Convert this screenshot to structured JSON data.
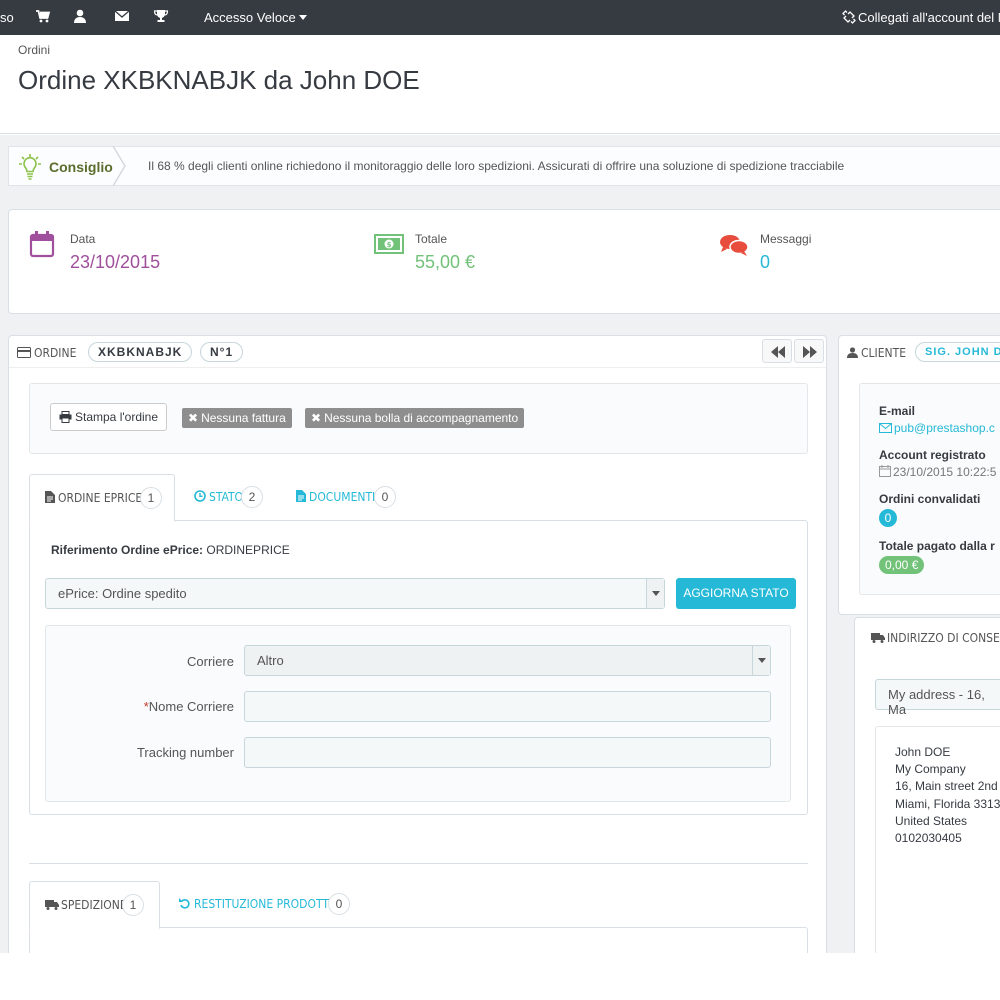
{
  "topbar": {
    "left_fragment": "so",
    "quick_access": "Accesso Veloce",
    "connect": "Collegati all'account del M",
    "icons": [
      "cart-icon",
      "user-icon",
      "envelope-icon",
      "trophy-icon"
    ]
  },
  "header": {
    "breadcrumb": "Ordini",
    "title": "Ordine XKBKNABJK da John DOE"
  },
  "tip": {
    "label": "Consiglio",
    "text": "Il 68 % degli clienti online richiedono il monitoraggio delle loro spedizioni. Assicurati di offrire una soluzione di spedizione tracciabile"
  },
  "kpis": [
    {
      "label": "Data",
      "value": "23/10/2015",
      "color": "#a04f9c"
    },
    {
      "label": "Totale",
      "value": "55,00 €",
      "color": "#72c279"
    },
    {
      "label": "Messaggi",
      "value": "0",
      "color": "#25b9d7"
    }
  ],
  "order_panel": {
    "title": "ORDINE",
    "reference": "XKBKNABJK",
    "number": "N°1",
    "print_button": "Stampa l'ordine",
    "tag_invoice": "Nessuna fattura",
    "tag_delivery": "Nessuna bolla di accompagnamento",
    "tabs": [
      {
        "label": "ORDINE EPRICE",
        "count": "1"
      },
      {
        "label": "STATO",
        "count": "2"
      },
      {
        "label": "DOCUMENTI",
        "count": "0"
      }
    ],
    "eprice_ref_label": "Riferimento Ordine ePrice:",
    "eprice_ref_value": "ORDINEPRICE",
    "status_select": "ePrice: Ordine spedito",
    "update_button": "AGGIORNA STATO",
    "carrier_label": "Corriere",
    "carrier_value": "Altro",
    "carrier_name_required": "*",
    "carrier_name_label": "Nome Corriere",
    "tracking_label": "Tracking number",
    "bottom_tabs": [
      {
        "label": "SPEDIZIONE",
        "count": "1"
      },
      {
        "label": "RESTITUZIONE PRODOTTO",
        "count": "0"
      }
    ]
  },
  "customer_panel": {
    "title": "CLIENTE",
    "name": "SIG. JOHN DO",
    "email_label": "E-mail",
    "email": "pub@prestashop.c",
    "registered_label": "Account registrato",
    "registered": "23/10/2015 10:22:5",
    "orders_label": "Ordini convalidati",
    "orders": "0",
    "paid_label": "Totale pagato dalla r",
    "paid": "0,00 €"
  },
  "address_panel": {
    "title": "INDIRIZZO DI CONSEGN",
    "select": "My address - 16, Ma",
    "lines": [
      "John DOE",
      "My Company",
      "16, Main street 2nd",
      "Miami, Florida 3313",
      "United States",
      "0102030405"
    ]
  },
  "colors": {
    "topbar": "#363a41",
    "accent": "#25b9d7",
    "tip_label": "#5b6d2c"
  }
}
